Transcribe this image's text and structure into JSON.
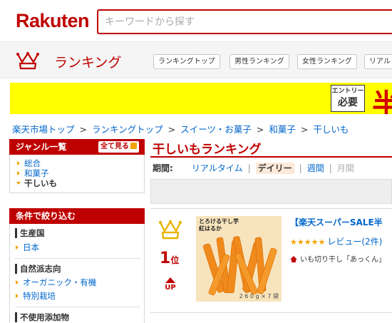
{
  "header": {
    "logo": "Rakuten",
    "search_placeholder": "キーワードから探す"
  },
  "ranking_bar": {
    "title": "ランキング",
    "nav": [
      "ランキングトップ",
      "男性ランキング",
      "女性ランキング",
      "リアル"
    ]
  },
  "banner": {
    "entry_line1": "エントリー",
    "entry_line2": "必要",
    "big_text": "半"
  },
  "breadcrumb": [
    "楽天市場トップ",
    "ランキングトップ",
    "スイーツ・お菓子",
    "和菓子",
    "干しいも"
  ],
  "breadcrumb_sep": ">",
  "sidebar": {
    "genre_title": "ジャンル一覧",
    "all_button": "全て見る",
    "genres": [
      "総合",
      "和菓子",
      "干しいも"
    ],
    "filter_title": "条件で絞り込む",
    "groups": [
      {
        "title": "生産国",
        "items": [
          "日本"
        ]
      },
      {
        "title": "自然派志向",
        "items": [
          "オーガニック・有機",
          "特別栽培"
        ]
      },
      {
        "title": "不使用添加物",
        "items": []
      }
    ]
  },
  "main": {
    "title": "干しいもランキング",
    "period_label": "期間:",
    "periods": [
      "リアルタイム",
      "デイリー",
      "週間",
      "月間"
    ],
    "period_sep": "|"
  },
  "item": {
    "rank": "1",
    "rank_unit": "位",
    "trend": "UP",
    "thumb_label": "とろける干し芋",
    "thumb_label2": "紅はるか",
    "thumb_weight": "2 6 0 g × 7 袋",
    "title": "【楽天スーパーSALE半",
    "stars": "★★★★★",
    "reviews": "レビュー(2件)",
    "shop": "いも切り干し「あっくん」"
  },
  "colors": {
    "brand": "#bf0000",
    "link": "#0066cc",
    "accent": "#f4a300",
    "banner": "#ffff00"
  }
}
